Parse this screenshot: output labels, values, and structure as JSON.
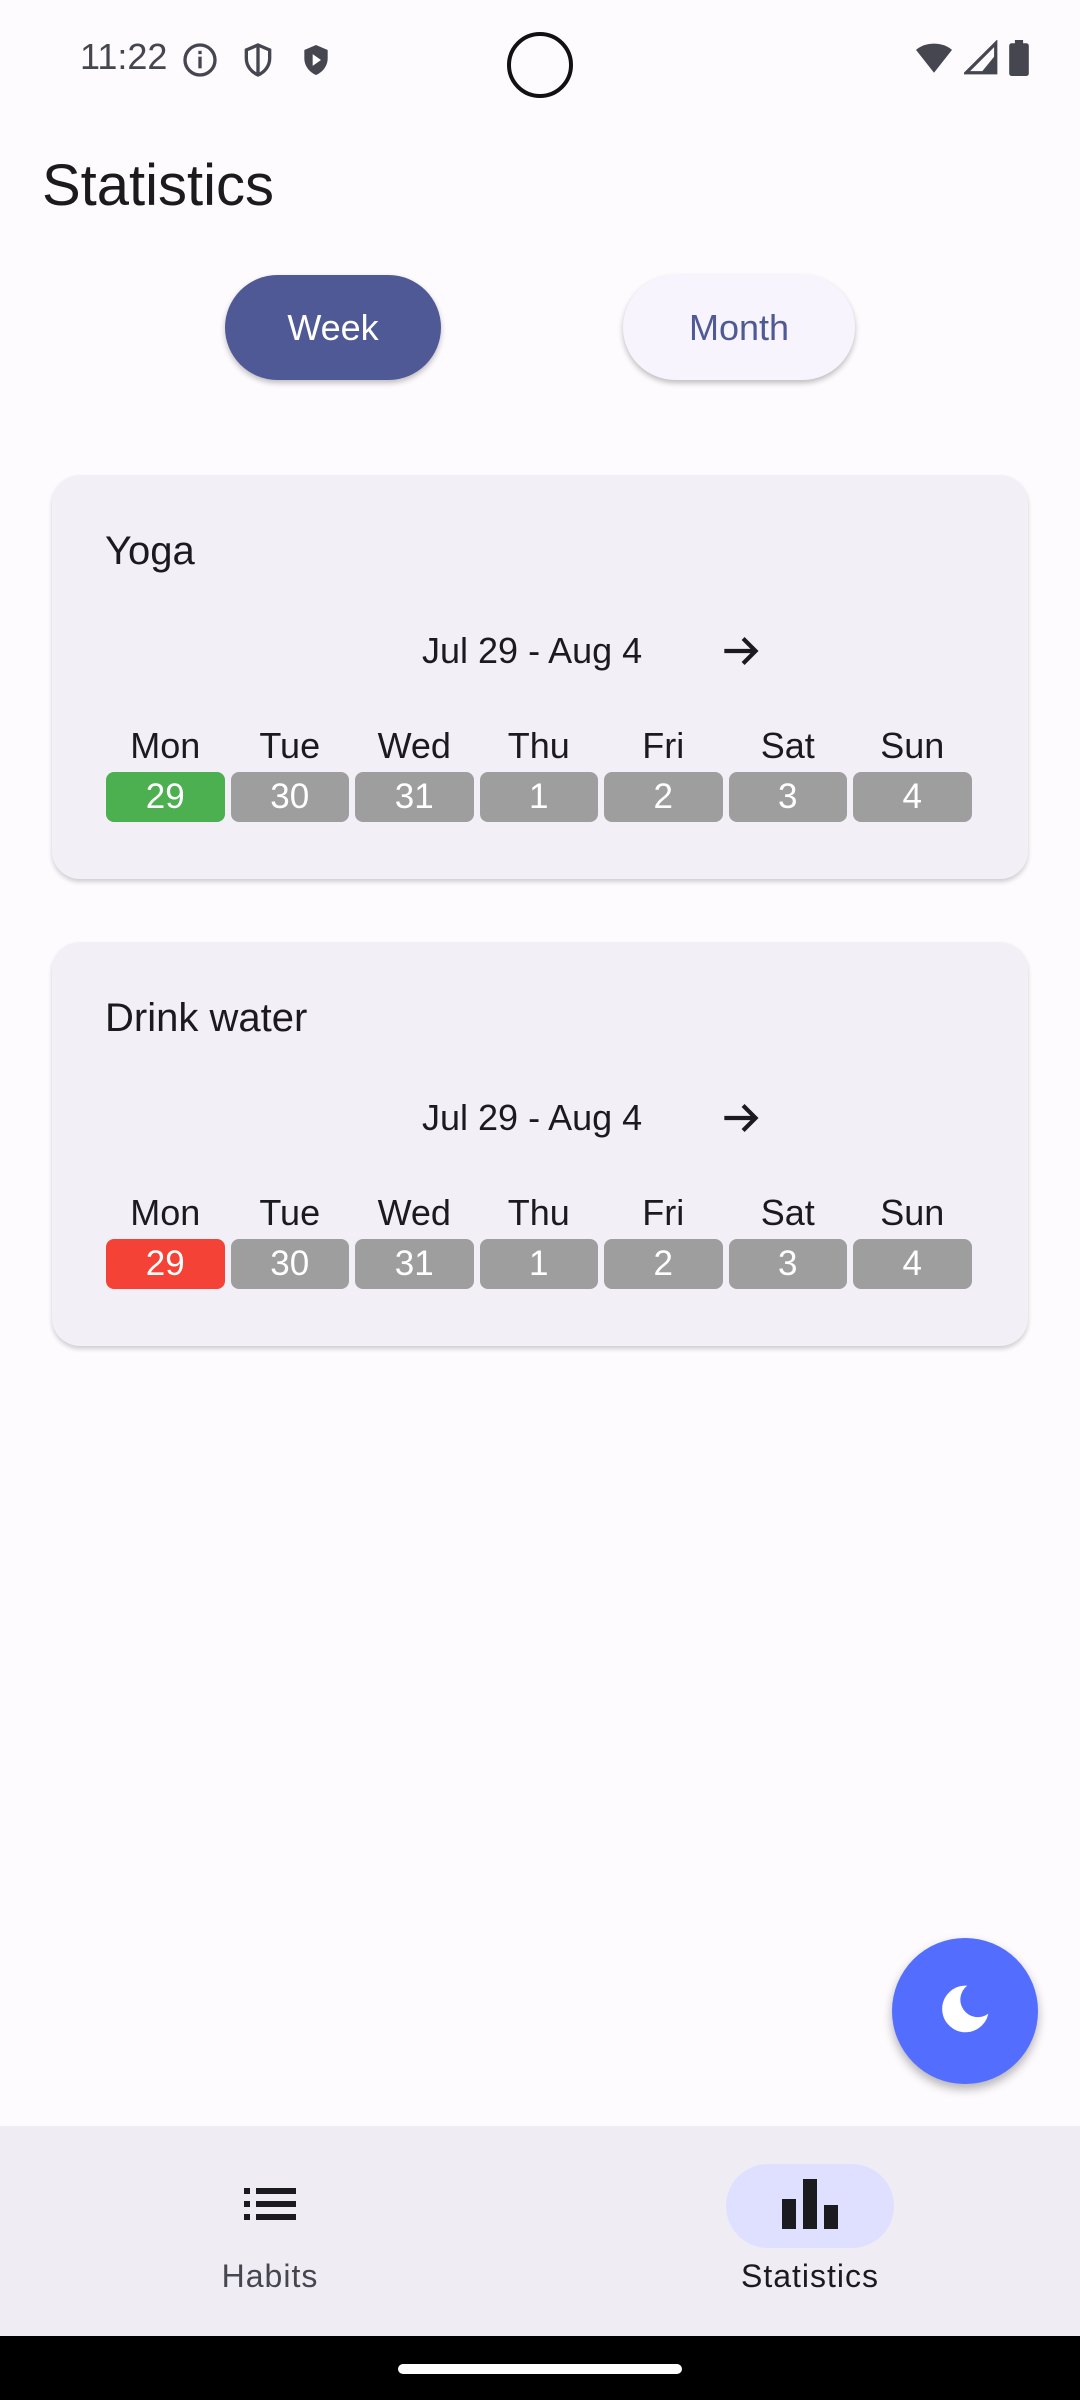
{
  "status_bar": {
    "time": "11:22"
  },
  "page": {
    "title": "Statistics"
  },
  "toggle": {
    "week_label": "Week",
    "month_label": "Month",
    "selected": "Week"
  },
  "habits": [
    {
      "name": "Yoga",
      "range": "Jul 29 - Aug 4",
      "day_names": [
        "Mon",
        "Tue",
        "Wed",
        "Thu",
        "Fri",
        "Sat",
        "Sun"
      ],
      "days": [
        "29",
        "30",
        "31",
        "1",
        "2",
        "3",
        "4"
      ],
      "day_colors": [
        "#4caf50",
        "#9e9e9e",
        "#9e9e9e",
        "#9e9e9e",
        "#9e9e9e",
        "#9e9e9e",
        "#9e9e9e"
      ]
    },
    {
      "name": "Drink water",
      "range": "Jul 29 - Aug 4",
      "day_names": [
        "Mon",
        "Tue",
        "Wed",
        "Thu",
        "Fri",
        "Sat",
        "Sun"
      ],
      "days": [
        "29",
        "30",
        "31",
        "1",
        "2",
        "3",
        "4"
      ],
      "day_colors": [
        "#f44336",
        "#9e9e9e",
        "#9e9e9e",
        "#9e9e9e",
        "#9e9e9e",
        "#9e9e9e",
        "#9e9e9e"
      ]
    }
  ],
  "fab": {
    "icon": "moon-icon",
    "color": "#536dfe"
  },
  "bottom_nav": {
    "items": [
      {
        "label": "Habits",
        "icon": "list-icon",
        "active": false
      },
      {
        "label": "Statistics",
        "icon": "bar-chart-icon",
        "active": true
      }
    ]
  },
  "colors": {
    "accent": "#4f5996",
    "done": "#4caf50",
    "missed": "#f44336",
    "neutral": "#9e9e9e"
  }
}
